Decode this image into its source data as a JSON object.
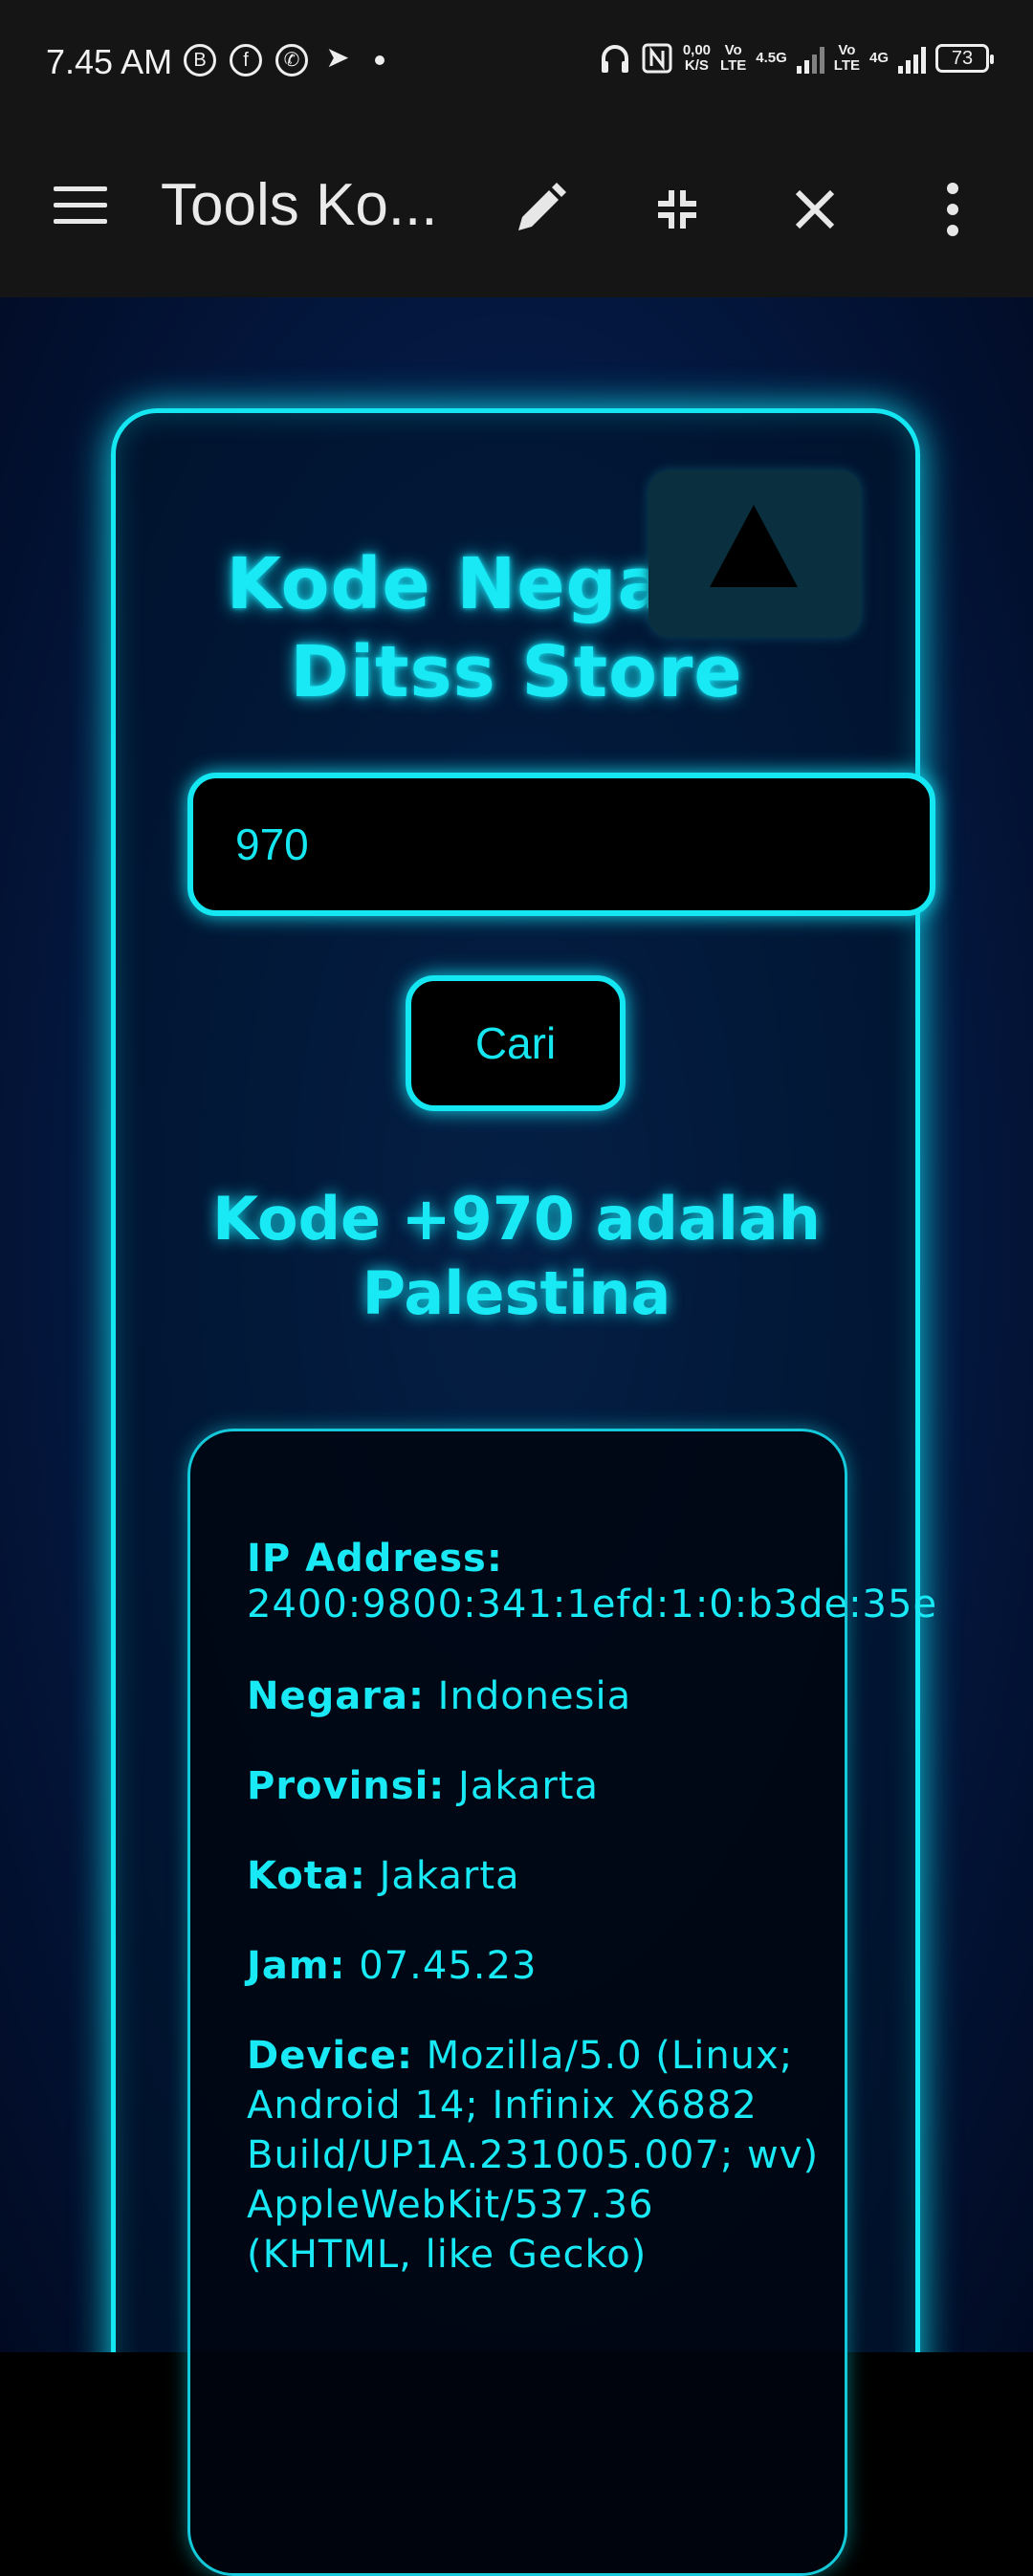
{
  "status_bar": {
    "time": "7.45 AM",
    "left_icons": [
      "whatsapp-business-icon",
      "facebook-icon",
      "whatsapp-icon",
      "telegram-icon",
      "dot-icon"
    ],
    "speed_value": "0,00",
    "speed_unit": "K/S",
    "volte1_top": "Vo",
    "volte1_bottom": "LTE",
    "network1": "4.5G",
    "volte2_top": "Vo",
    "volte2_bottom": "LTE",
    "network2": "4G",
    "battery": "73"
  },
  "app_bar": {
    "title": "Tools Ko...",
    "actions": [
      "edit-icon",
      "collapse-icon",
      "close-icon",
      "more-vert-icon"
    ]
  },
  "page": {
    "heading": "Kode Negara - Ditss Store",
    "search_value": "970",
    "search_button": "Cari",
    "result": "Kode +970 adalah Palestina",
    "info": {
      "ip_label": "IP Address:",
      "ip_value": "2400:9800:341:1efd:1:0:b3de:35e",
      "country_label": "Negara:",
      "country_value": "Indonesia",
      "province_label": "Provinsi:",
      "province_value": "Jakarta",
      "city_label": "Kota:",
      "city_value": "Jakarta",
      "time_label": "Jam:",
      "time_value": "07.45.23",
      "device_label": "Device:",
      "device_value": "Mozilla/5.0 (Linux; Android 14; Infinix X6882 Build/UP1A.231005.007; wv) AppleWebKit/537.36 (KHTML, like Gecko)"
    }
  },
  "colors": {
    "neon": "#14e6f2",
    "background": "#041a44",
    "appbar": "#151515"
  }
}
